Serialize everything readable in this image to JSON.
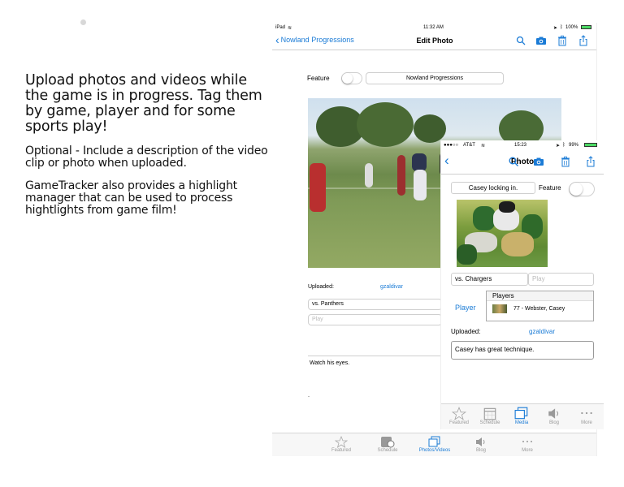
{
  "marketing": {
    "headline": "Upload photos and videos while the game is in progress. Tag them by game, player and for some sports play!",
    "optional": "Optional - Include a description of the video clip or photo when uploaded.",
    "highlights": "GameTracker also provides a highlight manager that can be used to process hightlights from game film!"
  },
  "ipad": {
    "status": {
      "carrier": "iPad",
      "time": "11:32 AM",
      "battery": "100%"
    },
    "nav": {
      "back_label": "Nowland Progressions",
      "title": "Edit Photo"
    },
    "feature_label": "Feature",
    "feature_on": false,
    "team_name": "Nowland Progressions",
    "uploaded_label": "Uploaded:",
    "uploaded_by": "gzaldivar",
    "game": "vs. Panthers",
    "play_placeholder": "Play",
    "description": "Watch his eyes.",
    "tabs": [
      {
        "label": "Featured",
        "icon": "star-icon",
        "active": false
      },
      {
        "label": "Schedule",
        "icon": "schedule-icon",
        "active": false
      },
      {
        "label": "Photos/Videos",
        "icon": "media-icon",
        "active": true
      },
      {
        "label": "Blog",
        "icon": "speaker-icon",
        "active": false
      },
      {
        "label": "More",
        "icon": "more-icon",
        "active": false
      }
    ]
  },
  "iphone": {
    "status": {
      "carrier": "AT&T",
      "time": "15:23",
      "battery": "99%"
    },
    "nav": {
      "title": "Photo"
    },
    "caption": "Casey locking in.",
    "feature_label": "Feature",
    "feature_on": false,
    "game": "vs. Chargers",
    "play_placeholder": "Play",
    "player_label": "Player",
    "players_header": "Players",
    "player_entry": "77 - Webster, Casey",
    "uploaded_label": "Uploaded:",
    "uploaded_by": "gzaldivar",
    "description": "Casey has great technique.",
    "tabs": [
      {
        "label": "Featured",
        "icon": "star-icon",
        "active": false
      },
      {
        "label": "Schedule",
        "icon": "calendar-icon",
        "active": false
      },
      {
        "label": "Media",
        "icon": "media-icon",
        "active": true
      },
      {
        "label": "Blog",
        "icon": "speaker-icon",
        "active": false
      },
      {
        "label": "More",
        "icon": "more-icon",
        "active": false
      }
    ]
  },
  "colors": {
    "accent": "#1a7bd6",
    "tab_inactive": "#999999"
  }
}
